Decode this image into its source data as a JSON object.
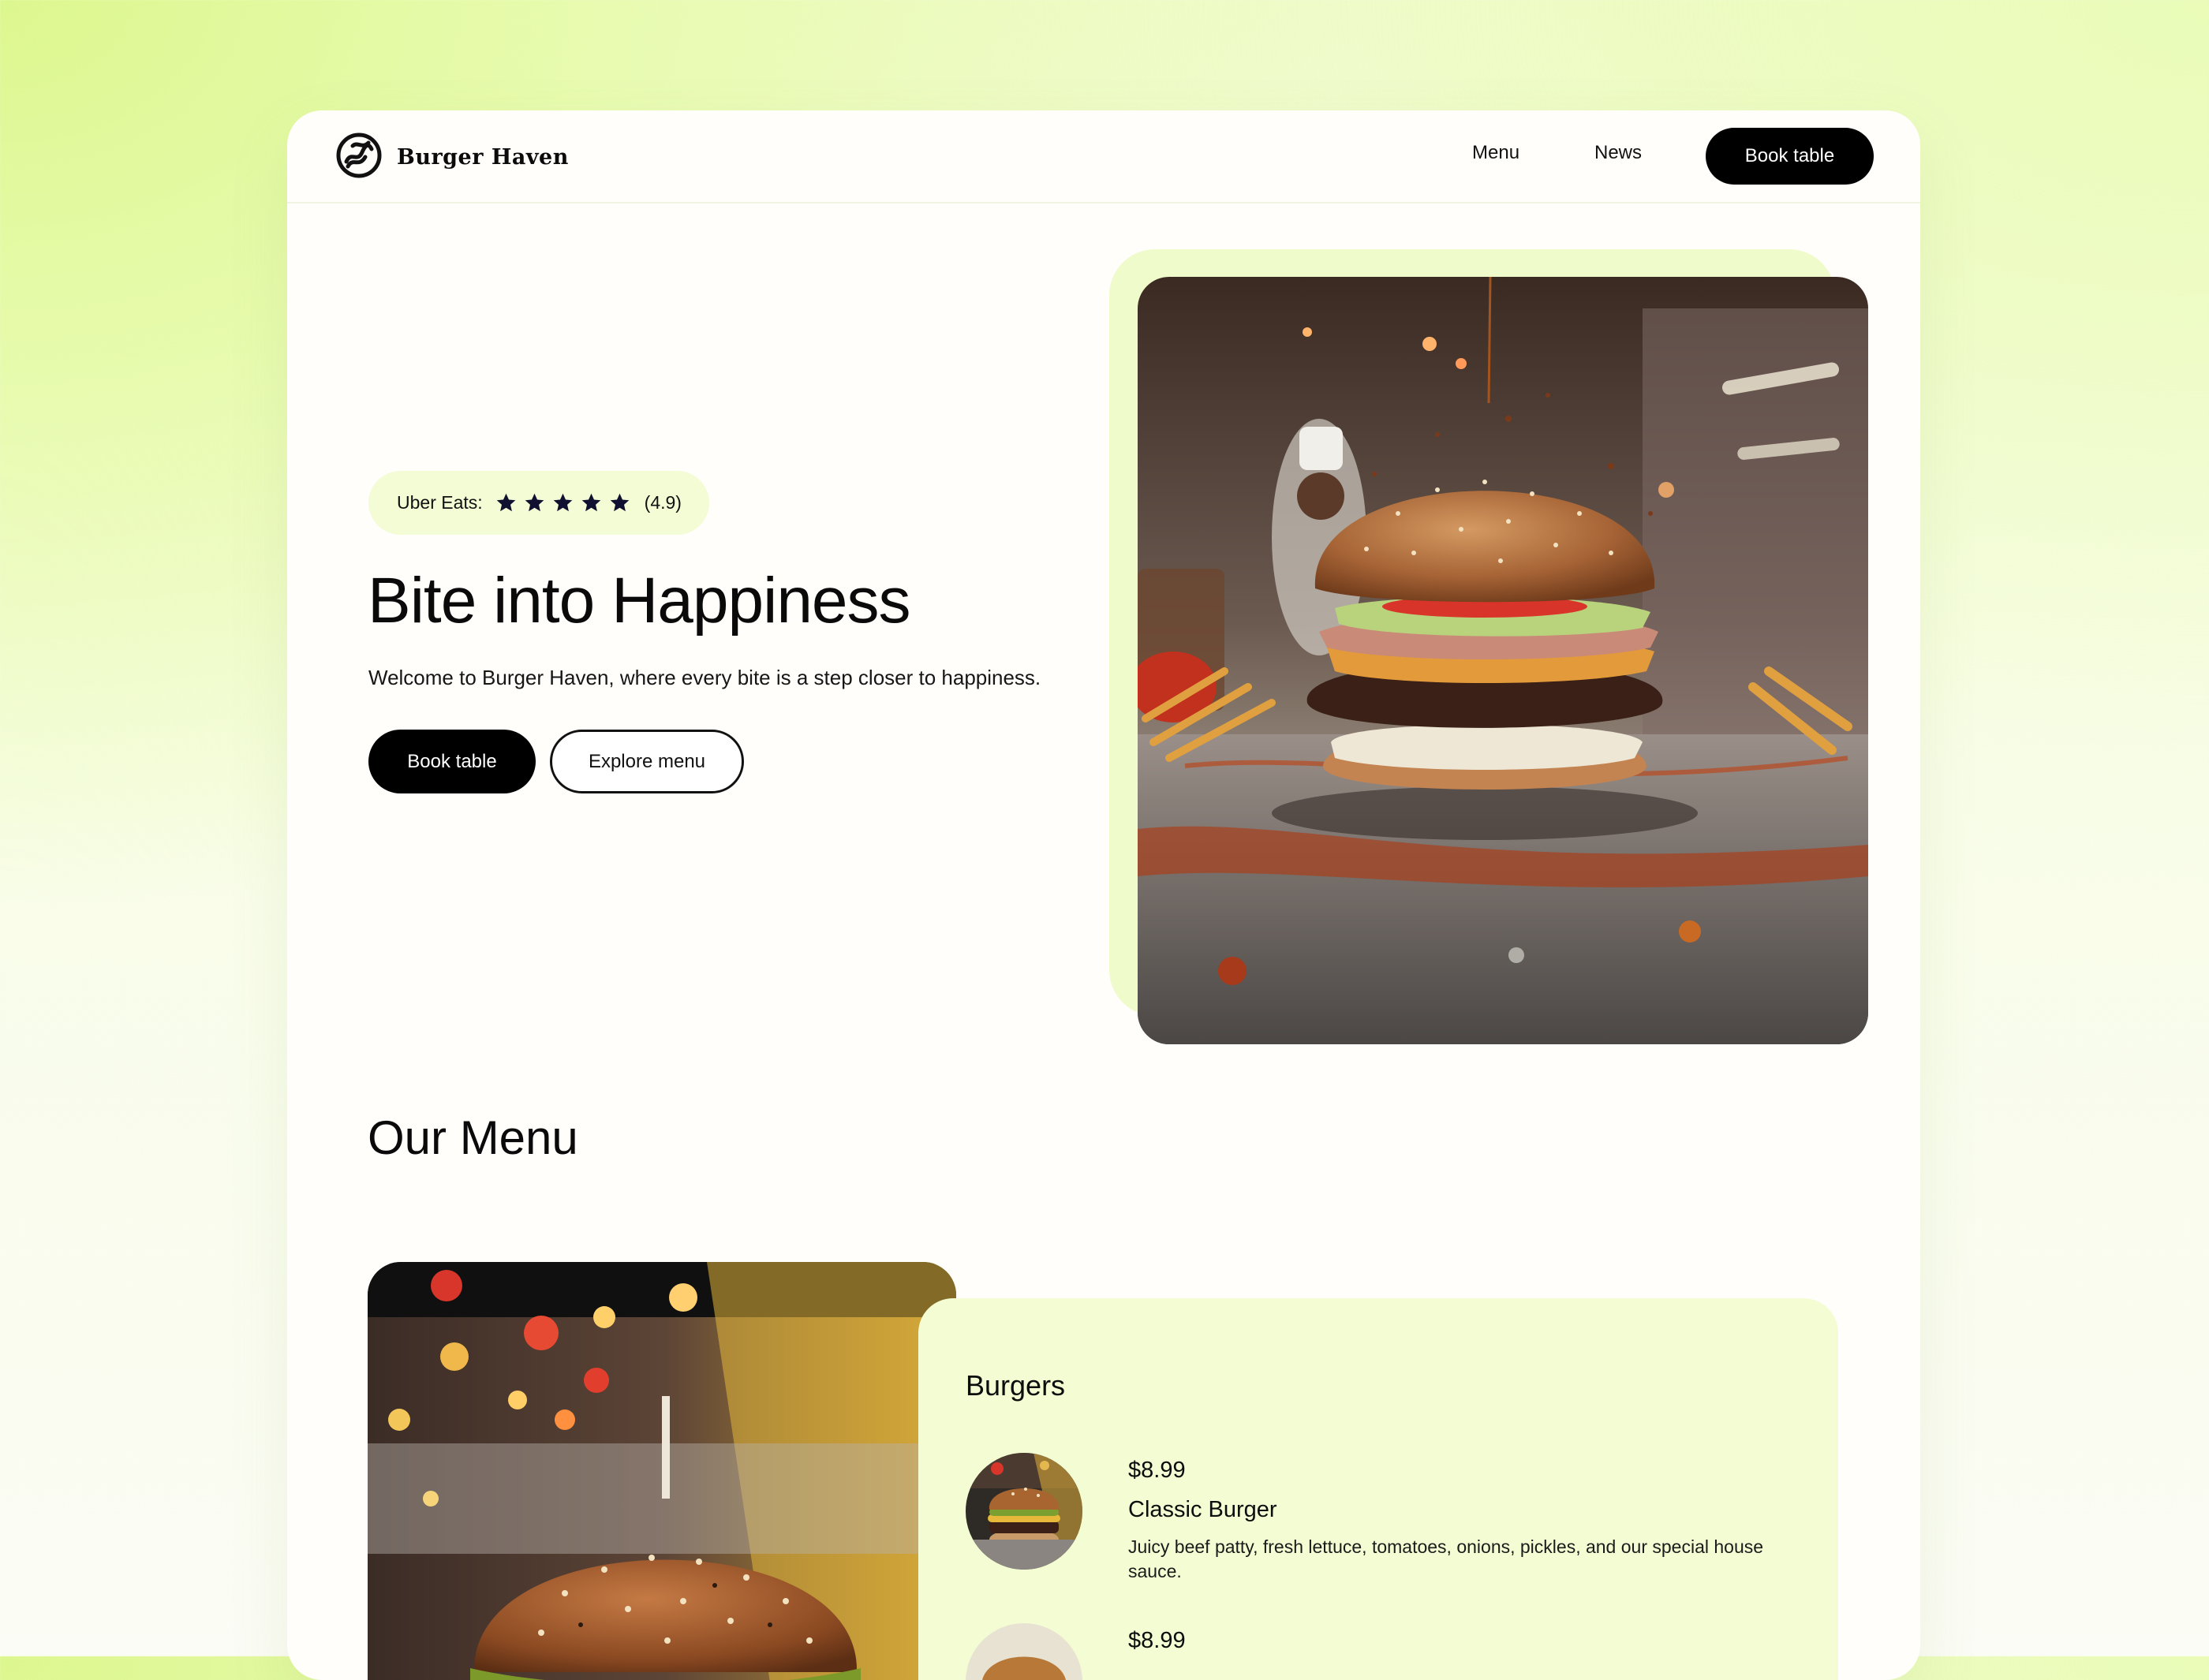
{
  "brand": {
    "name": "Burger Haven",
    "logo_icon": "swirl-logo-icon"
  },
  "nav": {
    "items": [
      "Menu",
      "News"
    ],
    "cta": "Book table"
  },
  "hero": {
    "rating_label": "Uber Eats:",
    "rating_stars": 5,
    "rating_value": "(4.9)",
    "title": "Bite into Happiness",
    "subtitle": "Welcome to Burger Haven, where every bite is a step closer to happiness.",
    "primary_button": "Book table",
    "secondary_button": "Explore menu"
  },
  "menu": {
    "title": "Our Menu",
    "category": "Burgers",
    "items": [
      {
        "price": "$8.99",
        "name": "Classic Burger",
        "description": "Juicy beef patty, fresh lettuce, tomatoes, onions, pickles, and our special house sauce."
      },
      {
        "price": "$8.99",
        "name": "",
        "description": ""
      }
    ]
  },
  "colors": {
    "accent": "#f3fcd5",
    "dark": "#000000",
    "background": "#e8fbb0"
  }
}
